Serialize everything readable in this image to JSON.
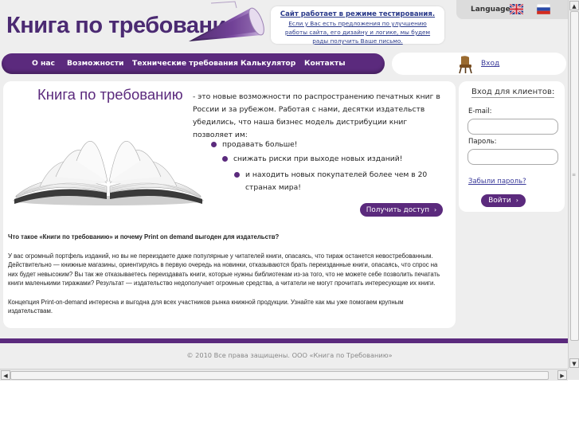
{
  "header": {
    "logo": "Книга по требованию",
    "notice_title": "Сайт работает в режиме тестирования.",
    "notice_body": "Если у Вас есть предложения по улучшению работы сайта, его дизайну и логике, мы будем рады получить Ваше письмо.",
    "language_label": "Language:",
    "languages": [
      "english-flag-icon",
      "russian-flag-icon"
    ]
  },
  "nav": {
    "items": [
      "О нас",
      "Возможности",
      "Технические требования",
      "Калькулятор",
      "Контакты"
    ],
    "login_link": "Вход"
  },
  "hero": {
    "title": "Книга по требованию",
    "intro": "- это новые возможности по распространению печатных книг в России и за рубежом. Работая с нами, десятки издательств убедились, что наша бизнес модель дистрибуции книг позволяет им:",
    "bullets": [
      "продавать больше!",
      "снижать риски при выходе новых изданий!",
      "и находить новых покупателей более чем в 20 странах мира!"
    ],
    "cta": "Получить доступ"
  },
  "article": {
    "heading": "Что такое «Книги по требованию» и почему Print on demand выгоден для издательств?",
    "paragraph1": "У вас огромный портфель изданий, но вы не переиздаете даже популярные у читателей книги, опасаясь, что тираж останется невостребованным. Действительно — книжные магазины, ориентируясь в первую очередь на новинки, отказываются брать переизданные книги, опасаясь, что спрос на них будет невысоким? Вы так же отказываетесь переиздавать книги, которые нужны библиотекам из-за того, что не можете себе позволить печатать книги маленькими тиражами? Результат — издательство недополучает огромные средства, а читатели не могут прочитать интересующие их книги.",
    "paragraph2": "Концепция Print-on-demand интересна и выгодна для всех участников рынка книжной продукции. Узнайте как мы уже помогаем крупным издательствам."
  },
  "login": {
    "title": "Вход для клиентов:",
    "email_label": "E-mail:",
    "password_label": "Пароль:",
    "email_value": "",
    "password_value": "",
    "forgot": "Забыли пароль?",
    "submit": "Войти"
  },
  "footer": {
    "copyright": "© 2010 Все права защищены. ООО «Книга по Требованию»"
  },
  "colors": {
    "brand_purple": "#5b2a7d",
    "page_background": "#eeeeee",
    "link_blue": "#3a3a9a"
  }
}
